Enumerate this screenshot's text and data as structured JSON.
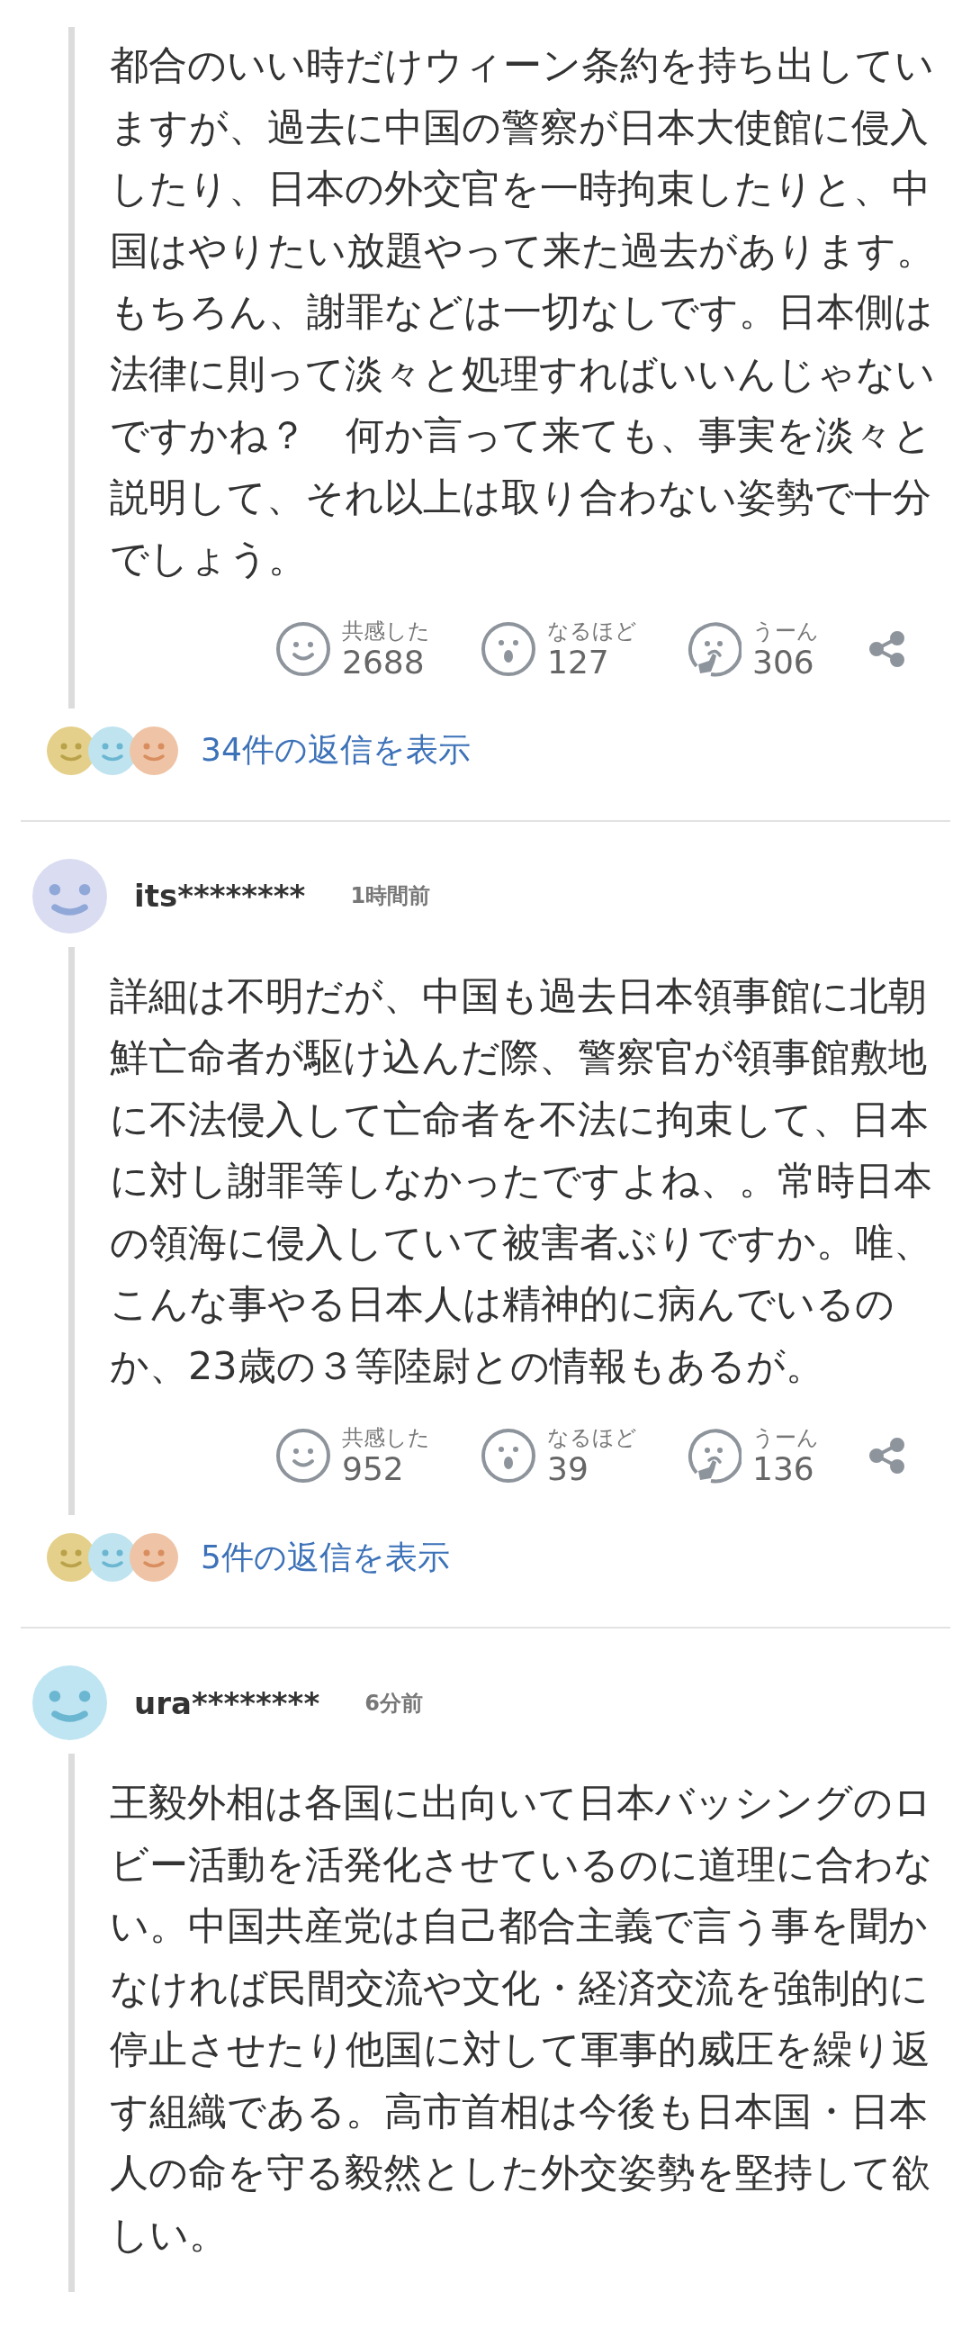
{
  "comments": [
    {
      "body": "都合のいい時だけウィーン条約を持ち出していますが、過去に中国の警察が日本大使館に侵入したり、日本の外交官を一時拘束したりと、中国はやりたい放題やって来た過去があります。もちろん、謝罪などは一切なしです。日本側は法律に則って淡々と処理すればいいんじゃないですかね？　何か言って来ても、事実を淡々と説明して、それ以上は取り合わない姿勢で十分でしょう。",
      "reactions": [
        {
          "kind": "smile",
          "label": "共感した",
          "count": "2688"
        },
        {
          "kind": "surprise",
          "label": "なるほど",
          "count": "127"
        },
        {
          "kind": "hmm",
          "label": "うーん",
          "count": "306"
        }
      ],
      "replies": "34件の返信を表示"
    },
    {
      "user": "its********",
      "time": "1時間前",
      "color": "#dadcf2",
      "body": "詳細は不明だが、中国も過去日本領事館に北朝鮮亡命者が駆け込んだ際、警察官が領事館敷地に不法侵入して亡命者を不法に拘束して、日本に対し謝罪等しなかったですよね、。常時日本の領海に侵入していて被害者ぶりですか。唯、こんな事やる日本人は精神的に病んでいるのか、23歳の３等陸尉との情報もあるが。",
      "reactions": [
        {
          "kind": "smile",
          "label": "共感した",
          "count": "952"
        },
        {
          "kind": "surprise",
          "label": "なるほど",
          "count": "39"
        },
        {
          "kind": "hmm",
          "label": "うーん",
          "count": "136"
        }
      ],
      "replies": "5件の返信を表示"
    },
    {
      "user": "ura********",
      "time": "6分前",
      "color": "#bfe5f2",
      "body": "王毅外相は各国に出向いて日本バッシングのロビー活動を活発化させているのに道理に合わない。中国共産党は自己都合主義で言う事を聞かなければ民間交流や文化・経済交流を強制的に停止させたり他国に対して軍事的威圧を繰り返す組織である。高市首相は今後も日本国・日本人の命を守る毅然とした外交姿勢を堅持して欲しい。"
    }
  ]
}
